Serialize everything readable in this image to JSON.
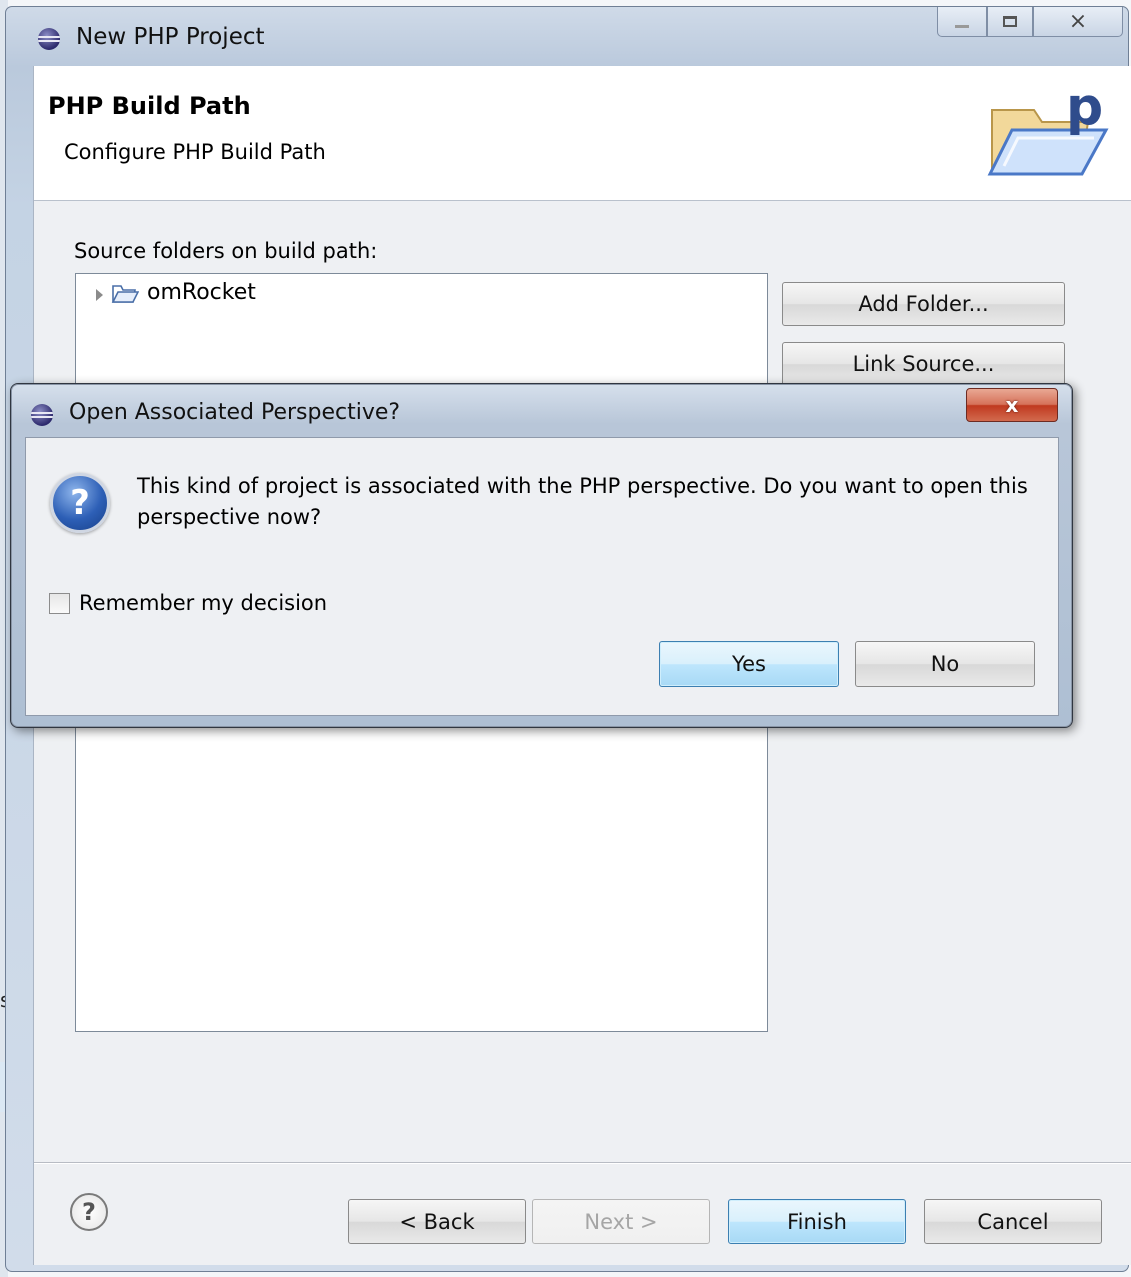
{
  "background": {
    "fragment_text": "s"
  },
  "window": {
    "title": "New PHP Project",
    "icon": "eclipse-icon",
    "controls": {
      "minimize": "minimize-icon",
      "maximize": "maximize-icon",
      "close": "close-icon",
      "close_glyph": "⨯"
    }
  },
  "banner": {
    "title": "PHP Build Path",
    "subtitle": "Configure PHP Build Path",
    "icon": "php-folder-icon"
  },
  "build_path": {
    "label": "Source folders on build path:",
    "tree_items": [
      {
        "label": "omRocket",
        "icon": "folder-icon",
        "expanded": false
      }
    ],
    "buttons": {
      "add_folder": "Add Folder...",
      "link_source": "Link Source..."
    }
  },
  "footer": {
    "help_glyph": "?",
    "back": "< Back",
    "next": "Next >",
    "finish": "Finish",
    "cancel": "Cancel"
  },
  "dialog": {
    "title": "Open Associated Perspective?",
    "close_glyph": "x",
    "icon": "question-icon",
    "icon_glyph": "?",
    "message": "This kind of project is associated with the PHP perspective.  Do you want to open this perspective now?",
    "checkbox_label": "Remember my decision",
    "checkbox_checked": false,
    "yes": "Yes",
    "no": "No"
  }
}
